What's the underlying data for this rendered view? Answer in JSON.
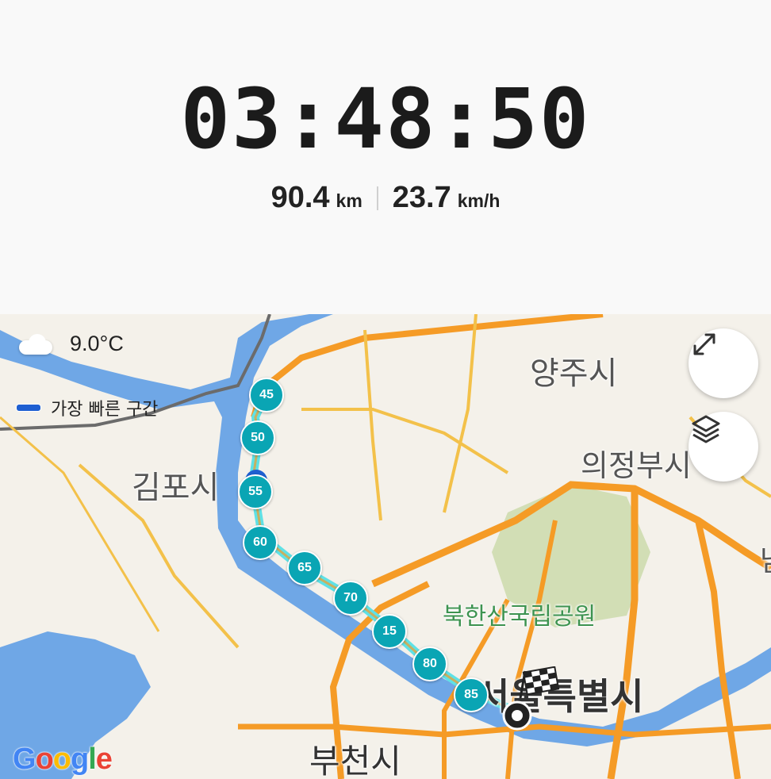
{
  "header": {
    "elapsed_time": "03:48:50",
    "distance_value": "90.4",
    "distance_unit": "km",
    "speed_value": "23.7",
    "speed_unit": "km/h"
  },
  "map": {
    "weather": {
      "icon": "cloud-icon",
      "temperature": "9.0°C"
    },
    "legend": {
      "label": "가장 빠른 구간",
      "color": "#1e5fd1"
    },
    "buttons": {
      "expand_icon": "expand-icon",
      "layers_icon": "layers-icon"
    },
    "places": {
      "yangju": "양주시",
      "uijeongbu": "의정부시",
      "gimpo": "김포시",
      "bukhansan": "북한산국립공원",
      "seoul": "서울특별시",
      "bucheon": "부천시",
      "cut_label": "남"
    },
    "km_markers": [
      "45",
      "50",
      "55",
      "60",
      "65",
      "70",
      "15",
      "80",
      "85"
    ],
    "route_color": "#5fe1e6",
    "marker_color": "#0aa5b4",
    "attribution": "Google"
  }
}
